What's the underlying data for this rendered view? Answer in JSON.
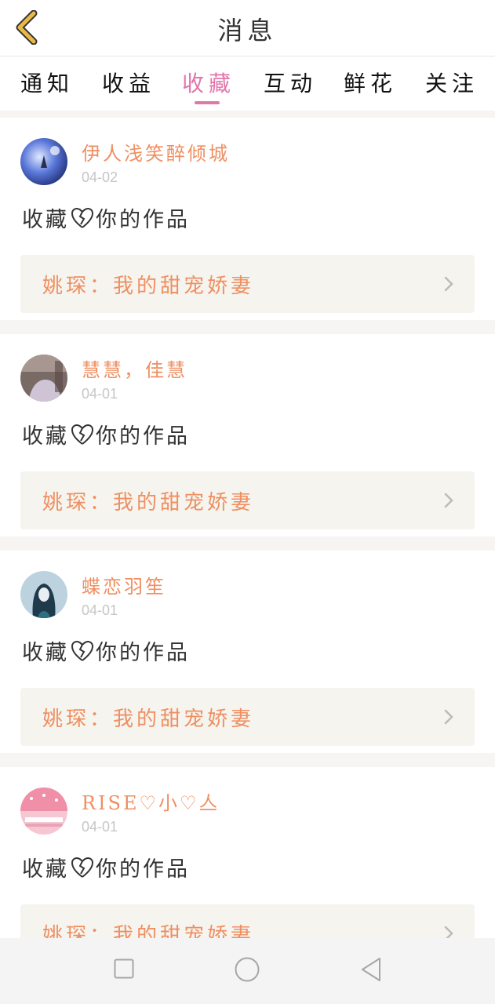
{
  "header": {
    "title": "消息"
  },
  "tabs": [
    {
      "label": "通知"
    },
    {
      "label": "收益"
    },
    {
      "label": "收藏"
    },
    {
      "label": "互动"
    },
    {
      "label": "鲜花"
    },
    {
      "label": "关注"
    }
  ],
  "active_tab": "收藏",
  "messages": [
    {
      "user": "伊人浅笑醉倾城",
      "date": "04-02",
      "action_prefix": "收藏",
      "action_suffix": "你的作品",
      "work": "姚琛：我的甜宠娇妻"
    },
    {
      "user": "慧慧，佳慧",
      "date": "04-01",
      "action_prefix": "收藏",
      "action_suffix": "你的作品",
      "work": "姚琛：我的甜宠娇妻"
    },
    {
      "user": "蝶恋羽笙",
      "date": "04-01",
      "action_prefix": "收藏",
      "action_suffix": "你的作品",
      "work": "姚琛：我的甜宠娇妻"
    },
    {
      "user": "RISE♡小♡亼",
      "date": "04-01",
      "action_prefix": "收藏",
      "action_suffix": "你的作品",
      "work": "姚琛：我的甜宠娇妻"
    }
  ],
  "icons": {
    "back": "chevron-left-icon",
    "heart": "broken-heart-icon",
    "arrow": "chevron-right-icon",
    "nav_recent": "square-icon",
    "nav_home": "circle-icon",
    "nav_back": "triangle-back-icon"
  },
  "colors": {
    "accent_pink": "#e276ab",
    "name_orange": "#ef8f62",
    "back_gold": "#e8b84a",
    "work_box_bg": "#f5f4ee",
    "feed_bg": "#f7f4f4"
  }
}
